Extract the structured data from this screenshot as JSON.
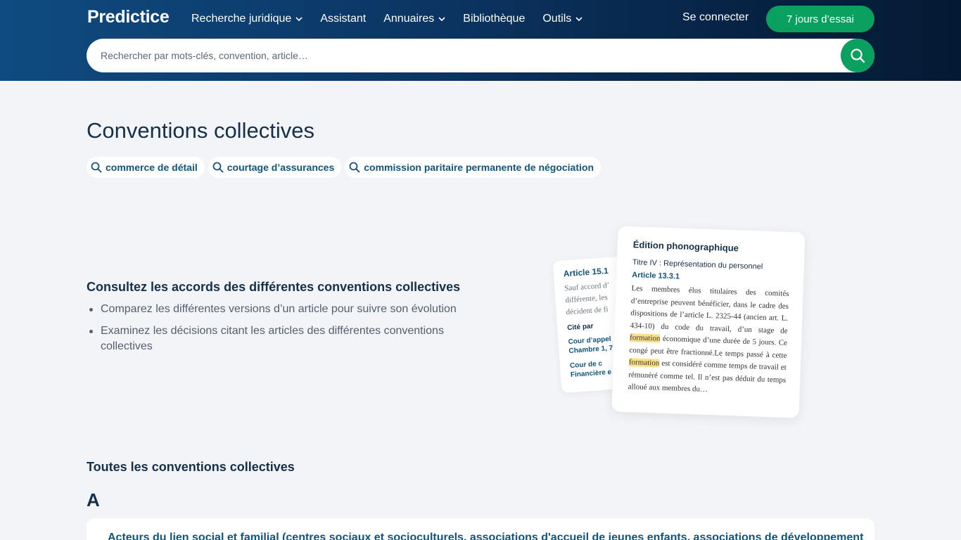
{
  "header": {
    "logo": "Predictice",
    "nav": [
      {
        "label": "Recherche juridique",
        "dropdown": true
      },
      {
        "label": "Assistant",
        "dropdown": false
      },
      {
        "label": "Annuaires",
        "dropdown": true
      },
      {
        "label": "Bibliothèque",
        "dropdown": false
      },
      {
        "label": "Outils",
        "dropdown": true
      }
    ],
    "login": "Se connecter",
    "trial": "7 jours d’essai",
    "search_placeholder": "Rechercher par mots-clés, convention, article…"
  },
  "page": {
    "title": "Conventions collectives",
    "chips": [
      "commerce de détail",
      "courtage d’assurances",
      "commission paritaire permanente de négociation"
    ]
  },
  "feature": {
    "heading": "Consultez les accords des différentes conventions collectives",
    "bullets": [
      "Comparez les différentes versions d’un article pour suivre son évolution",
      "Examinez les décisions citant les articles des différentes conventions collectives"
    ]
  },
  "illustration": {
    "back": {
      "title": "Article 15.1",
      "lines": [
        "Sauf accord d’",
        "différente, les",
        "décident de fi"
      ],
      "cite": "Cité par",
      "links": [
        "Cour d’appel",
        "Chambre 1, 7",
        "Cour de c",
        "Financière e"
      ]
    },
    "front": {
      "title": "Édition phonographique",
      "subtitle": "Titre IV : Représentation du personnel",
      "article": "Article 13.3.1",
      "body_1": "Les membres élus titulaires des comités d’entreprise peuvent bénéficier, dans le cadre des dispositions de l’article L. 2325-44 (ancien art. L. 434-10) du code du travail, d’un stage de ",
      "highlight_1": "formation",
      "body_2": " économique d’une durée de 5 jours. Ce congé peut être fractionné.Le temps passé à cette ",
      "highlight_2": "formation",
      "body_3": " est considéré comme temps de travail et rémunéré comme tel. Il n’est pas déduit du temps alloué aux membres du…"
    }
  },
  "list": {
    "title": "Toutes les conventions collectives",
    "letter": "A",
    "first_item": "Acteurs du lien social et familial (centres sociaux et socioculturels, associations d'accueil de jeunes enfants, associations de développement"
  },
  "colors": {
    "header_start": "#0f4b80",
    "header_end": "#041a33",
    "accent_green": "#0aa05f",
    "link_blue": "#10557f",
    "page_bg": "#f2f4f7",
    "highlight": "#fbe08a"
  },
  "icons": {
    "nav_dropdown": "chevron-down-icon",
    "search": "search-icon",
    "chip": "magnifier-icon"
  }
}
